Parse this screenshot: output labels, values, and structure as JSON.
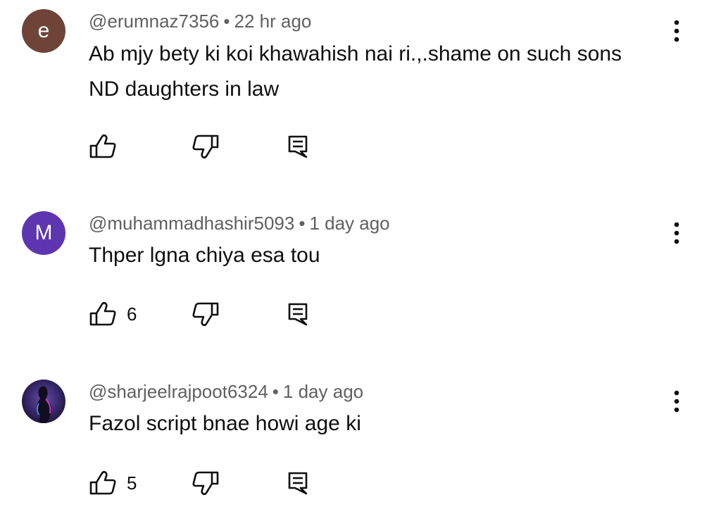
{
  "comments": [
    {
      "avatar": {
        "type": "letter",
        "letter": "e",
        "color": "#6d4437"
      },
      "handle": "@erumnaz7356",
      "time": "22 hr ago",
      "text": "Ab mjy bety ki koi khawahish nai ri.,.shame on such sons ND daughters in law",
      "likes": ""
    },
    {
      "avatar": {
        "type": "letter",
        "letter": "M",
        "color": "#5e35b1"
      },
      "handle": "@muhammadhashir5093",
      "time": "1 day ago",
      "text": "Thper lgna chiya esa tou",
      "likes": "6"
    },
    {
      "avatar": {
        "type": "image",
        "description": "dark-figure-photo"
      },
      "handle": "@sharjeelrajpoot6324",
      "time": "1 day ago",
      "text": "Fazol script bnae howi age ki",
      "likes": "5"
    }
  ],
  "ui": {
    "separator": "•",
    "icons": {
      "like": "thumb-up-icon",
      "dislike": "thumb-down-icon",
      "reply": "reply-comment-icon",
      "more": "more-vert-icon"
    }
  }
}
